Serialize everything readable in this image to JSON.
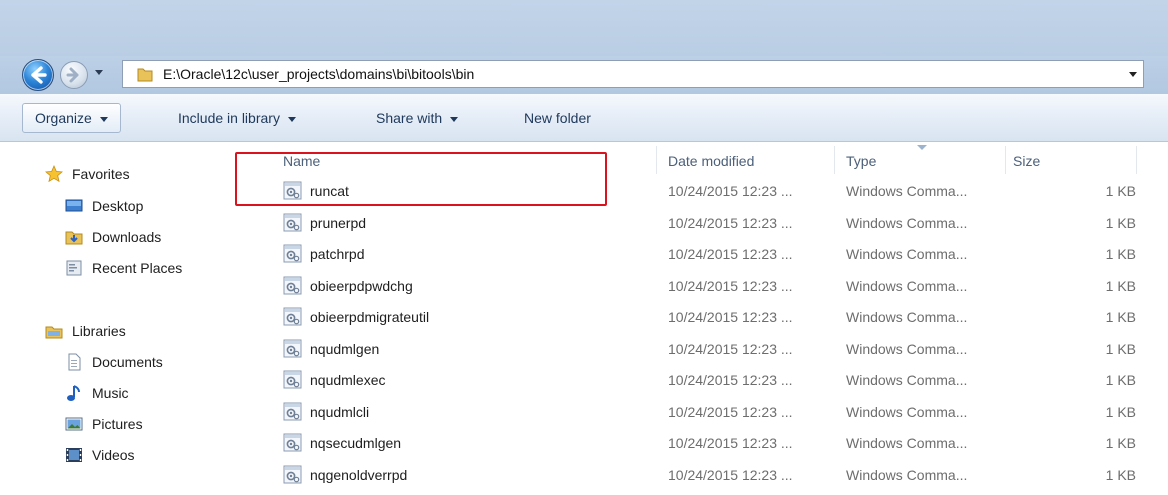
{
  "address": {
    "path": "E:\\Oracle\\12c\\user_projects\\domains\\bi\\bitools\\bin"
  },
  "toolbar": {
    "organize": "Organize",
    "include_in_library": "Include in library",
    "share_with": "Share with",
    "new_folder": "New folder"
  },
  "nav": {
    "favorites": "Favorites",
    "desktop": "Desktop",
    "downloads": "Downloads",
    "recent_places": "Recent Places",
    "libraries": "Libraries",
    "documents": "Documents",
    "music": "Music",
    "pictures": "Pictures",
    "videos": "Videos"
  },
  "columns": {
    "name": "Name",
    "date": "Date modified",
    "type": "Type",
    "size": "Size"
  },
  "files": [
    {
      "name": "runcat",
      "date": "10/24/2015 12:23 ...",
      "type": "Windows Comma...",
      "size": "1 KB"
    },
    {
      "name": "prunerpd",
      "date": "10/24/2015 12:23 ...",
      "type": "Windows Comma...",
      "size": "1 KB"
    },
    {
      "name": "patchrpd",
      "date": "10/24/2015 12:23 ...",
      "type": "Windows Comma...",
      "size": "1 KB"
    },
    {
      "name": "obieerpdpwdchg",
      "date": "10/24/2015 12:23 ...",
      "type": "Windows Comma...",
      "size": "1 KB"
    },
    {
      "name": "obieerpdmigrateutil",
      "date": "10/24/2015 12:23 ...",
      "type": "Windows Comma...",
      "size": "1 KB"
    },
    {
      "name": "nqudmlgen",
      "date": "10/24/2015 12:23 ...",
      "type": "Windows Comma...",
      "size": "1 KB"
    },
    {
      "name": "nqudmlexec",
      "date": "10/24/2015 12:23 ...",
      "type": "Windows Comma...",
      "size": "1 KB"
    },
    {
      "name": "nqudmlcli",
      "date": "10/24/2015 12:23 ...",
      "type": "Windows Comma...",
      "size": "1 KB"
    },
    {
      "name": "nqsecudmlgen",
      "date": "10/24/2015 12:23 ...",
      "type": "Windows Comma...",
      "size": "1 KB"
    },
    {
      "name": "nqgenoldverrpd",
      "date": "10/24/2015 12:23 ...",
      "type": "Windows Comma...",
      "size": "1 KB"
    }
  ],
  "colors": {
    "highlight": "#d9141f",
    "toolbar_text": "#1e395b"
  }
}
